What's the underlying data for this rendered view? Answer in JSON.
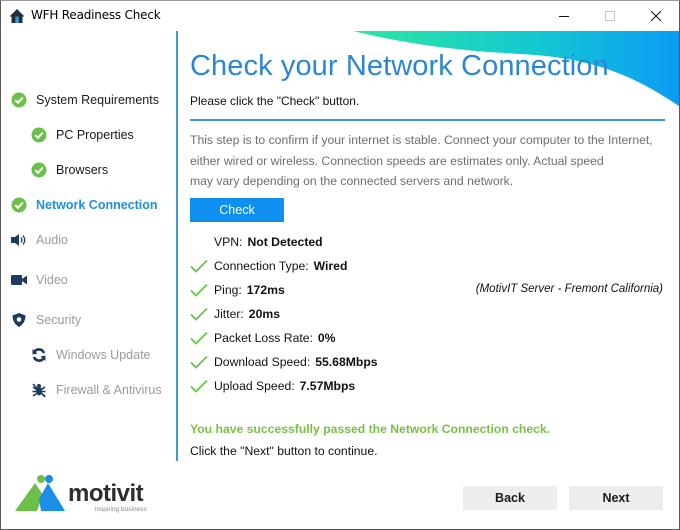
{
  "window": {
    "title": "WFH Readiness Check",
    "icons": {
      "app": "house-icon",
      "minimize": "minimize-icon",
      "maximize": "maximize-icon",
      "close": "close-icon"
    }
  },
  "sidebar": {
    "items": [
      {
        "label": "System Requirements",
        "state": "done",
        "icon": "check-circle-icon",
        "level": 0
      },
      {
        "label": "PC Properties",
        "state": "done",
        "icon": "check-circle-icon",
        "level": 1
      },
      {
        "label": "Browsers",
        "state": "done",
        "icon": "check-circle-icon",
        "level": 1
      },
      {
        "label": "Network Connection",
        "state": "active",
        "icon": "check-circle-icon",
        "level": 0
      },
      {
        "label": "Audio",
        "state": "pending",
        "icon": "speaker-icon",
        "level": 0
      },
      {
        "label": "Video",
        "state": "pending",
        "icon": "video-camera-icon",
        "level": 0
      },
      {
        "label": "Security",
        "state": "pending",
        "icon": "shield-icon",
        "level": 0
      },
      {
        "label": "Windows Update",
        "state": "pending",
        "icon": "refresh-icon",
        "level": 1
      },
      {
        "label": "Firewall & Antivirus",
        "state": "pending",
        "icon": "bug-icon",
        "level": 1
      }
    ]
  },
  "logo": {
    "brand": "motivit",
    "tagline": "inspiring business"
  },
  "main": {
    "title": "Check your Network Connection",
    "subtitle": "Please click the \"Check\" button.",
    "description_lines": [
      "This step is to confirm if your internet is stable. Connect your computer to the Internet,",
      "either wired or wireless. Connection speeds  are estimates only. Actual speed",
      "may vary depending on the connected servers and  network."
    ],
    "check_button": "Check",
    "results": [
      {
        "label": "VPN:",
        "value": "Not Detected",
        "passed": false
      },
      {
        "label": "Connection Type:",
        "value": "Wired",
        "passed": true
      },
      {
        "label": "Ping:",
        "value": "172ms",
        "passed": true
      },
      {
        "label": "Jitter:",
        "value": "20ms",
        "passed": true
      },
      {
        "label": "Packet Loss Rate:",
        "value": "0%",
        "passed": true
      },
      {
        "label": "Download Speed:",
        "value": "55.68Mbps",
        "passed": true
      },
      {
        "label": "Upload Speed:",
        "value": "7.57Mbps",
        "passed": true
      }
    ],
    "server_note": "(MotivIT Server - Fremont California)",
    "success_message": "You have successfully passed the Network Connection check.",
    "next_hint": "Click the \"Next\" button to continue."
  },
  "footer": {
    "back_label": "Back",
    "next_label": "Next"
  },
  "colors": {
    "accent_blue": "#2b86d4",
    "button_blue": "#0f8ff0",
    "success_green": "#7ac143",
    "check_green": "#6cc04a",
    "icon_navy": "#1e3a5c",
    "disabled_gray": "#9b9b9b"
  }
}
